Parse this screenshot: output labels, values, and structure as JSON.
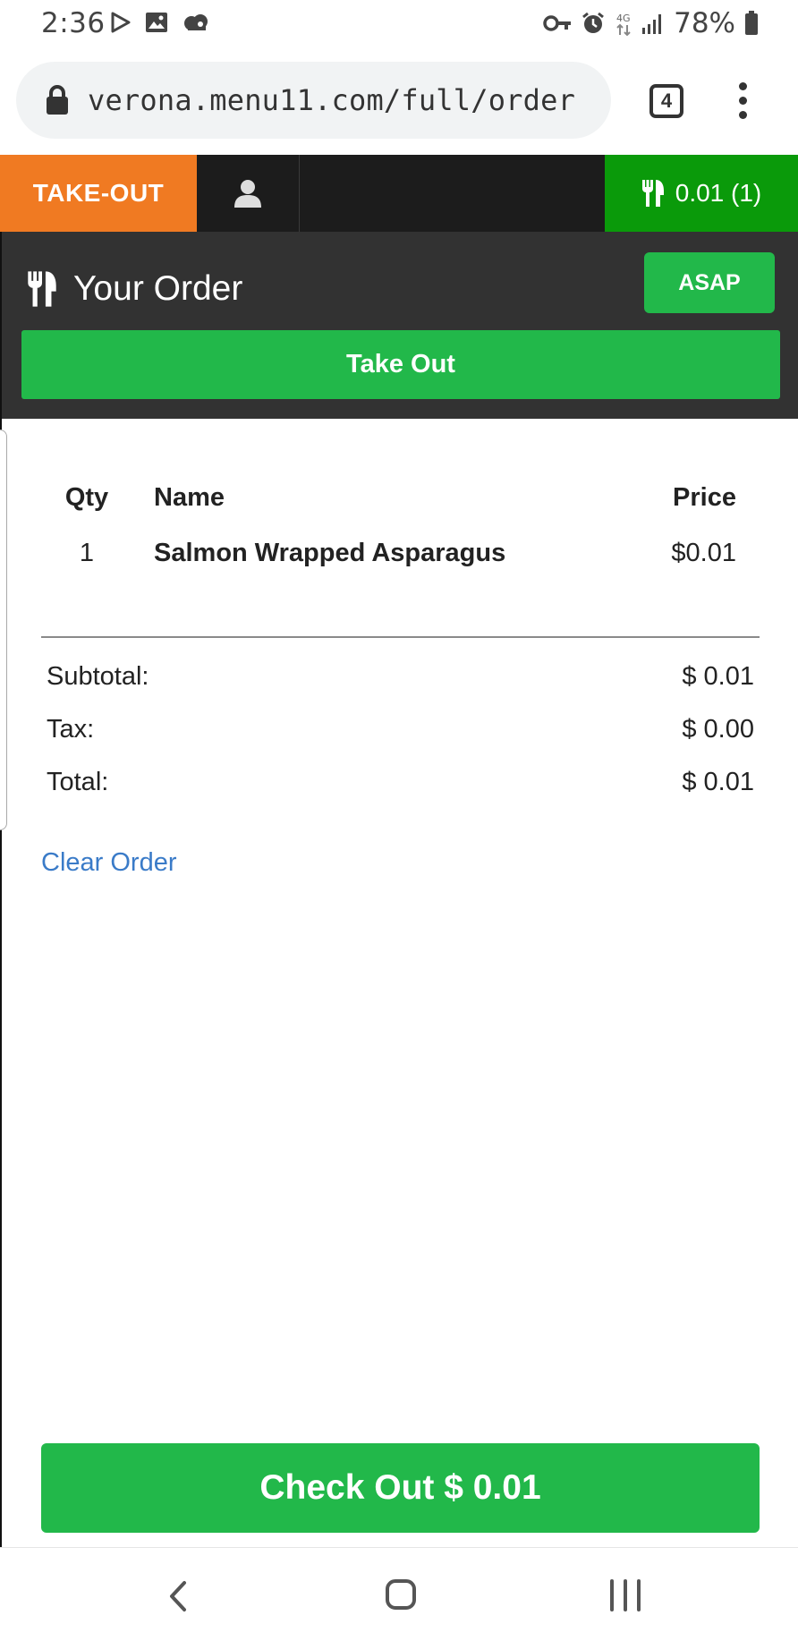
{
  "status_bar": {
    "time": "2:36",
    "battery": "78%"
  },
  "browser": {
    "url": "verona.menu11.com/full/order",
    "tab_count": "4"
  },
  "nav": {
    "takeout_label": "TAKE-OUT",
    "cart_label": "0.01 (1)"
  },
  "order_header": {
    "title": "Your Order",
    "asap_label": "ASAP",
    "order_type_label": "Take Out"
  },
  "table": {
    "headers": {
      "qty": "Qty",
      "name": "Name",
      "price": "Price"
    },
    "items": [
      {
        "qty": "1",
        "name": "Salmon Wrapped Asparagus",
        "price": "$0.01"
      }
    ]
  },
  "totals": {
    "subtotal_label": "Subtotal:",
    "subtotal_value": "$ 0.01",
    "tax_label": "Tax:",
    "tax_value": "$ 0.00",
    "total_label": "Total:",
    "total_value": "$ 0.01"
  },
  "clear_order_label": "Clear Order",
  "checkout_label": "Check Out $ 0.01",
  "colors": {
    "takeout_orange": "#f07a22",
    "cart_green": "#0a9a0a",
    "button_green": "#22b84a",
    "header_dark": "#323232",
    "nav_dark": "#1c1c1c",
    "link_blue": "#3a7bc8"
  },
  "icons": {
    "status_left": [
      "play-store-icon",
      "image-icon",
      "cloud-icon"
    ],
    "status_right": [
      "vpn-key-icon",
      "alarm-icon",
      "data-icon",
      "signal-icon",
      "battery-icon"
    ],
    "lock": "lock-icon",
    "user": "user-icon",
    "utensils": "utensils-icon"
  }
}
